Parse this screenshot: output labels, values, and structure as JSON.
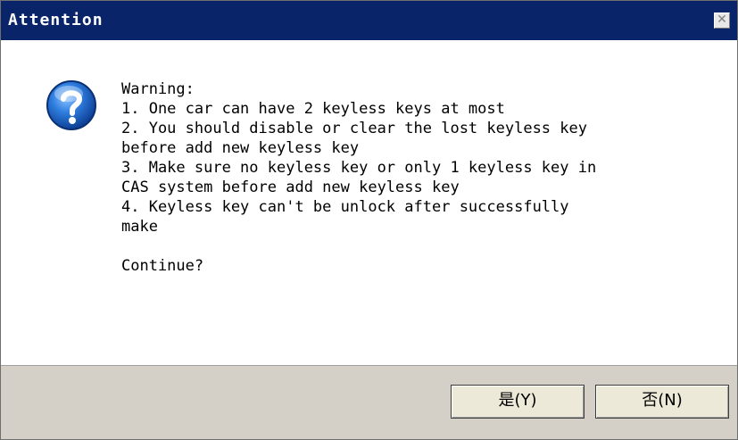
{
  "dialog": {
    "title": "Attention",
    "close_glyph": "✕",
    "icon": "question-icon",
    "message_lines": [
      "Warning:",
      "1. One car can have 2 keyless keys at most",
      "2. You should disable or clear the lost keyless key",
      "before add new keyless key",
      "3. Make sure no keyless key or only 1 keyless key in",
      "CAS system before add new keyless key",
      "4. Keyless key can't be unlock after successfully",
      "make",
      "",
      "Continue?"
    ],
    "buttons": {
      "yes_label": "是(Y)",
      "no_label": "否(N)"
    }
  },
  "colors": {
    "titlebar": "#0a246a",
    "button_bar": "#d4d0c8",
    "icon_blue": "#1e63c6"
  }
}
